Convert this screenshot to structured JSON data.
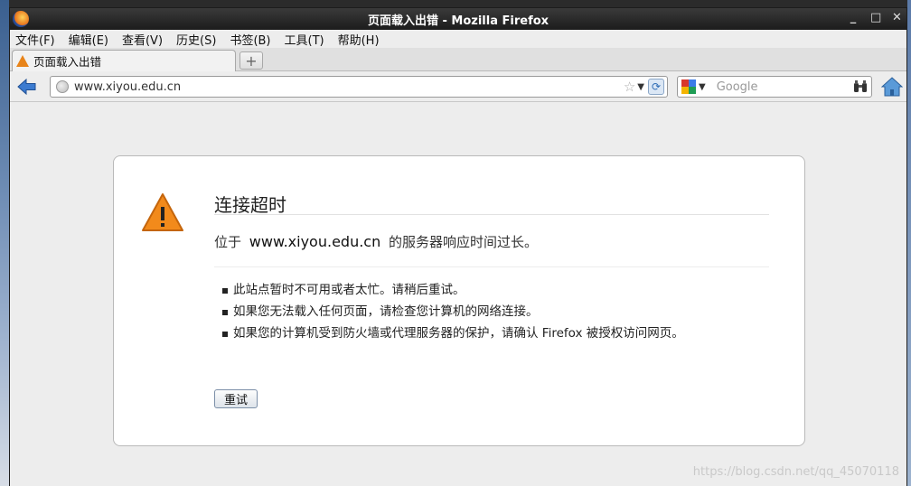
{
  "window": {
    "title": "页面载入出错 - Mozilla Firefox",
    "controls": [
      "_",
      "□",
      "✕"
    ]
  },
  "menubar": {
    "items": [
      "文件(F)",
      "编辑(E)",
      "查看(V)",
      "历史(S)",
      "书签(B)",
      "工具(T)",
      "帮助(H)"
    ]
  },
  "tabs": [
    {
      "label": "页面载入出错"
    }
  ],
  "newtab_label": "+",
  "nav": {
    "url": "www.xiyou.edu.cn",
    "search_placeholder": "Google"
  },
  "error": {
    "title": "连接超时",
    "desc_prefix": "位于",
    "host": "www.xiyou.edu.cn",
    "desc_suffix": "的服务器响应时间过长。",
    "bullets": [
      "此站点暂时不可用或者太忙。请稍后重试。",
      "如果您无法载入任何页面，请检查您计算机的网络连接。",
      "如果您的计算机受到防火墙或代理服务器的保护，请确认 Firefox 被授权访问网页。"
    ],
    "retry_label": "重试"
  },
  "watermark": "https://blog.csdn.net/qq_45070118",
  "colors": {
    "warning": "#e8841a",
    "link_blue": "#2f6db5"
  }
}
